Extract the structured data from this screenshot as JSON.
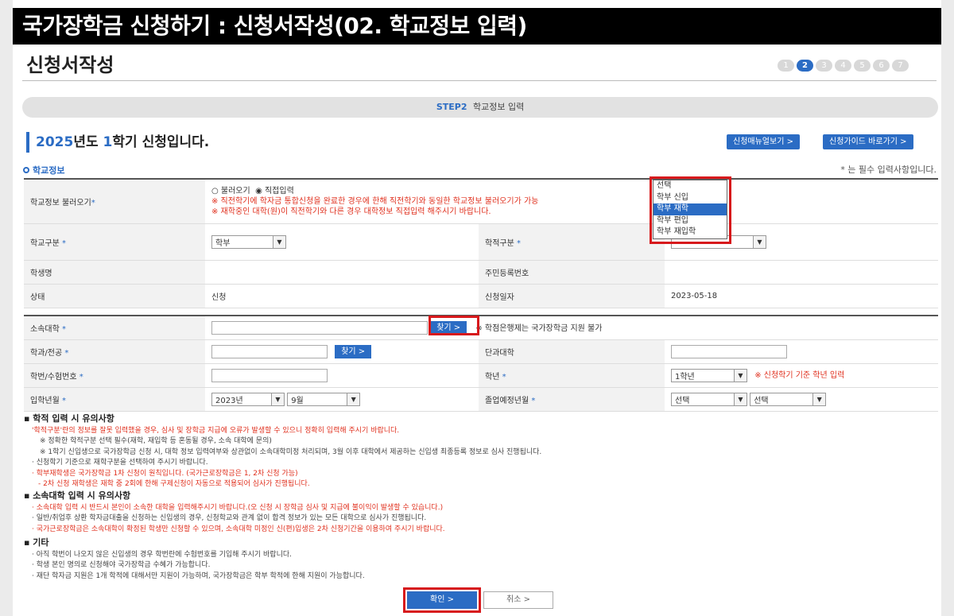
{
  "window_title": "국가장학금 신청하기 : 신청서작성(02. 학교정보 입력)",
  "page_title": "신청서작성",
  "steps": [
    "1",
    "2",
    "3",
    "4",
    "5",
    "6",
    "7"
  ],
  "active_step": "2",
  "step_bar": {
    "label": "STEP2",
    "text": "학교정보 입력"
  },
  "period": {
    "year": "2025",
    "year_suffix": "년도",
    "term": "1",
    "term_suffix": "학기 신청입니다."
  },
  "top_buttons": {
    "manual": "신청매뉴얼보기 >",
    "guide": "신청가이드 바로가기 >"
  },
  "section_label": "학교정보",
  "required_note": "* 는 필수 입력사항입니다.",
  "school_info": {
    "load_label": "학교정보 불러오기",
    "load_options": [
      "불러오기",
      "직접입력"
    ],
    "load_selected": "직접입력",
    "load_note1": "※ 직전학기에 학자금 통합신청을 완료한 경우에 한해 직전학기와 동일한 학교정보 불러오기가 가능",
    "load_note2": "※ 재학중인 대학(원)이 직전학기와 다른 경우 대학정보 직접입력 해주시기 바랍니다.",
    "school_type_label": "학교구분",
    "school_type_value": "학부",
    "academic_type_label": "학적구분",
    "student_name_label": "학생명",
    "student_name_value": "",
    "rrn_label": "주민등록번호",
    "rrn_value": "",
    "status_label": "상태",
    "status_value": "신청",
    "apply_date_label": "신청일자",
    "apply_date_value": "2023-05-18"
  },
  "academic_dropdown": {
    "options": [
      "선택",
      "학부 신입",
      "학부 재학",
      "학부 편입",
      "학부 재입학"
    ],
    "highlighted": "학부 재학"
  },
  "univ_info": {
    "univ_label": "소속대학",
    "univ_value": "",
    "find_label": "찾기 >",
    "univ_note": "※ 학점은행제는 국가장학금 지원 불가",
    "dept_label": "학과/전공",
    "dept_value": "",
    "college_label": "단과대학",
    "college_value": "",
    "student_no_label": "학번/수험번호",
    "student_no_value": "",
    "grade_label": "학년",
    "grade_value": "1학년",
    "grade_note": "※ 신청학기 기준 학년 입력",
    "entry_label": "입학년월",
    "entry_year": "2023년",
    "entry_month": "9월",
    "grad_label": "졸업예정년월",
    "grad_year": "선택",
    "grad_month": "선택"
  },
  "notes": [
    {
      "heading": "학적 입력 시 유의사항",
      "lines": [
        {
          "text": "'학적구분'란의 정보를 잘못 입력했을 경우, 심사 및 장학금 지급에 오류가 발생할 수 있으니 정확히 입력해 주시기 바랍니다.",
          "red": true
        },
        {
          "text": "※ 정확한 학적구분 선택 필수(재학, 재입학 등 혼동될 경우, 소속 대학에 문의)",
          "red": false
        },
        {
          "text": "※ 1학기 신입생으로 국가장학금 신청 시, 대학 정보 입력여부와 상관없이 소속대학미정 처리되며, 3월 이후 대학에서 제공하는 신입생 최종등록 정보로 심사 진행됩니다.",
          "red": false
        },
        {
          "text": "· 신청학기 기준으로 재학구분을 선택하여 주시기 바랍니다.",
          "red": false
        },
        {
          "text": "· 학부재학생은 국가장학금 1차 신청이 원칙입니다. (국가근로장학금은 1, 2차 신청 가능)",
          "red": true
        },
        {
          "text": "- 2차 신청 재학생은 재학 중 2회에 한해 구제신청이 자동으로 적용되어 심사가 진행됩니다.",
          "red": true
        }
      ]
    },
    {
      "heading": "소속대학 입력 시 유의사항",
      "lines": [
        {
          "text": "· 소속대학 입력 시 반드시 본인이 소속한 대학을 입력해주시기 바랍니다.(오 신청 시 장학금 심사 및 지급에 불이익이 발생할 수 있습니다.)",
          "red": true
        },
        {
          "text": "· 일반/취업후 상환 학자금대출을 신청하는 신입생의 경우, 신청학교와 관계 없이 합격 정보가 있는 모든 대학으로 심사가 진행됩니다.",
          "red": false
        },
        {
          "text": "· 국가근로장학금은 소속대학이 확정된 학생만 신청할 수 있으며, 소속대학 미정인 신(편)입생은 2차 신청기간을 이용하여 주시기 바랍니다.",
          "red": true
        }
      ]
    },
    {
      "heading": "기타",
      "lines": [
        {
          "text": "· 아직 학번이 나오지 않은 신입생의 경우 학번란에 수험번호를 기입해 주시기 바랍니다.",
          "red": false
        },
        {
          "text": "· 학생 본인 명의로 신청해야 국가장학금 수혜가 가능합니다.",
          "red": false
        },
        {
          "text": "· 재단 학자금 지원은 1개 학적에 대해서만 지원이 가능하며, 국가장학금은 학부 학적에 한해 지원이 가능합니다.",
          "red": false
        }
      ]
    }
  ],
  "buttons": {
    "confirm": "확인  >",
    "cancel": "취소  >"
  },
  "colors": {
    "accent": "#2b6cc4",
    "warning": "#e0301e",
    "highlight_box": "#d7191c"
  }
}
